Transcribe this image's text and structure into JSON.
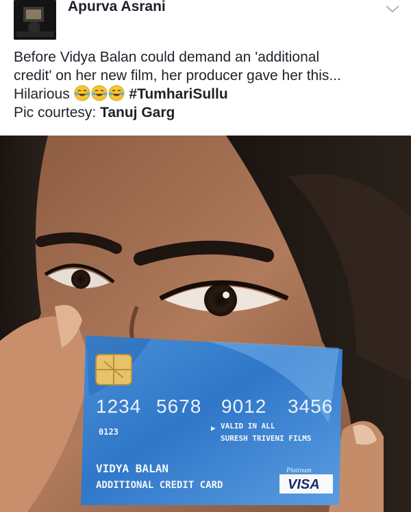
{
  "post": {
    "author": "Apurva Asrani",
    "text_line1": "Before Vidya Balan could demand an 'additional",
    "text_line2": "credit' on her new film, her producer gave her this...",
    "hilarious": "Hilarious",
    "emoji_names": [
      "face-with-tears-of-joy-icon",
      "face-with-tears-of-joy-icon",
      "face-with-tears-of-joy-icon"
    ],
    "hashtag": "#TumhariSullu",
    "credit_label": "Pic courtesy:",
    "credit_name": "Tanuj Garg"
  },
  "card": {
    "number_groups": [
      "1234",
      "5678",
      "9012",
      "3456"
    ],
    "small_code": "0123",
    "valid_line1": "VALID IN ALL",
    "valid_line2": "SURESH TRIVENI FILMS",
    "holder": "VIDYA BALAN",
    "card_title": "ADDITIONAL CREDIT CARD",
    "brand": "VISA",
    "tier": "Platinum"
  },
  "colors": {
    "card_blue": "#2f7fd0",
    "text": "#1d2129"
  }
}
